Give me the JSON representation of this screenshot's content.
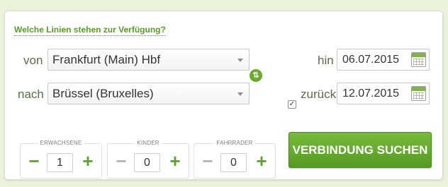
{
  "form": {
    "title_link": "Welche Linien stehen zur Verfügung?",
    "from_label": "von",
    "from_value": "Frankfurt (Main) Hbf",
    "to_label": "nach",
    "to_value": "Brüssel (Bruxelles)",
    "swap_icon": "swap-arrows-icon",
    "outbound_label": "hin",
    "outbound_date": "06.07.2015",
    "return_label": "zurück",
    "return_checked": true,
    "return_date": "12.07.2015",
    "calendar_icon": "calendar-icon"
  },
  "counters": [
    {
      "label": "ERWACHSENE",
      "value": "1",
      "minus": "−",
      "plus": "+"
    },
    {
      "label": "KINDER",
      "value": "0",
      "minus": "−",
      "plus": "+"
    },
    {
      "label": "FAHRRÄDER",
      "value": "0",
      "minus": "−",
      "plus": "+"
    }
  ],
  "search_button": "VERBINDUNG SUCHEN",
  "colors": {
    "accent_green": "#5ea52a",
    "page_background": "#e9f2db"
  }
}
